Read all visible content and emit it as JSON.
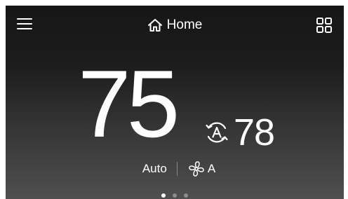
{
  "header": {
    "title": "Home",
    "menu_icon": "hamburger-menu-icon",
    "home_icon": "home-icon",
    "grid_icon": "grid-icon"
  },
  "thermostat": {
    "current_temperature": "75",
    "setpoint": "78",
    "setpoint_icon": "auto-mode-icon",
    "mode": "Auto",
    "fan_icon": "fan-icon",
    "fan_mode": "A"
  },
  "pagination": {
    "total": 3,
    "active_index": 0
  },
  "colors": {
    "background_top": "#161616",
    "background_bottom": "#4f4f4f",
    "text": "#ffffff",
    "inactive_dot": "#8c8c8c"
  }
}
